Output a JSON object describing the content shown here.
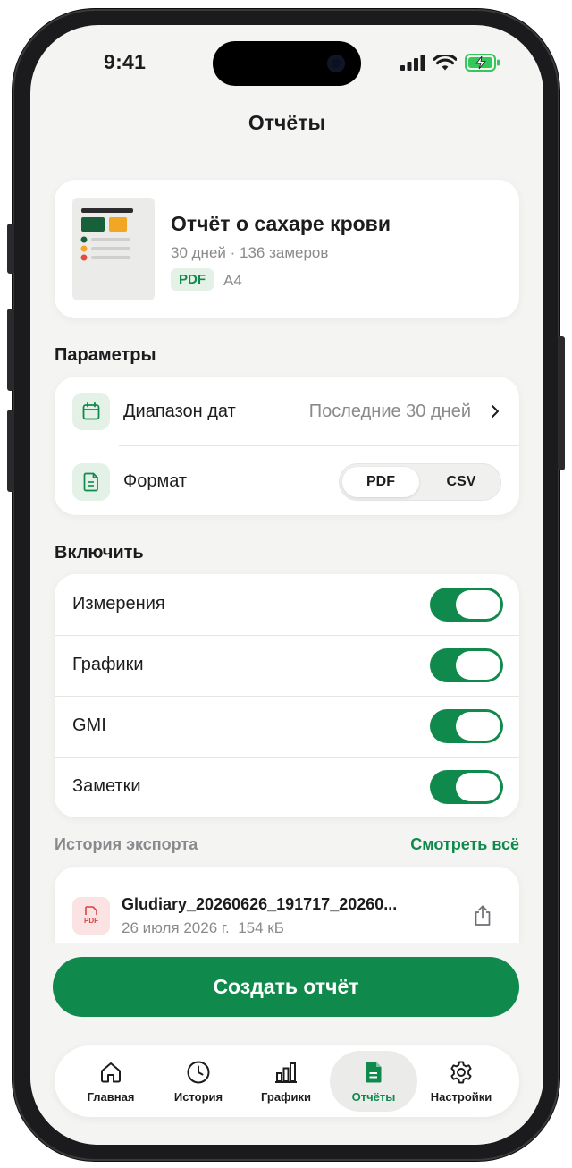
{
  "status_bar": {
    "time": "9:41"
  },
  "header": {
    "title": "Отчёты"
  },
  "report": {
    "title": "Отчёт о сахаре крови",
    "subtitle": "30 дней · 136 замеров",
    "format_tag": "PDF",
    "paper_size": "A4"
  },
  "params": {
    "section_title": "Параметры",
    "date_range": {
      "label": "Диапазон дат",
      "value": "Последние 30 дней"
    },
    "format": {
      "label": "Формат",
      "options": [
        "PDF",
        "CSV"
      ],
      "selected": "PDF"
    }
  },
  "include": {
    "section_title": "Включить",
    "items": [
      {
        "label": "Измерения",
        "on": true
      },
      {
        "label": "Графики",
        "on": true
      },
      {
        "label": "GMI",
        "on": true
      },
      {
        "label": "Заметки",
        "on": true
      }
    ]
  },
  "history": {
    "section_title": "История экспорта",
    "see_all": "Смотреть всё",
    "items": [
      {
        "name": "Gludiary_20260626_191717_20260...",
        "date": "26 июля 2026 г.",
        "size": "154 кБ",
        "icon_text": "PDF"
      }
    ]
  },
  "actions": {
    "create": "Создать отчёт"
  },
  "tabbar": {
    "tabs": [
      {
        "label": "Главная",
        "icon": "home-icon"
      },
      {
        "label": "История",
        "icon": "clock-icon"
      },
      {
        "label": "Графики",
        "icon": "chart-icon"
      },
      {
        "label": "Отчёты",
        "icon": "document-icon"
      },
      {
        "label": "Настройки",
        "icon": "gear-icon"
      }
    ],
    "active": "Отчёты"
  },
  "colors": {
    "accent": "#0f8a4c",
    "background": "#f4f4f2",
    "muted_text": "#8a8a8e"
  }
}
